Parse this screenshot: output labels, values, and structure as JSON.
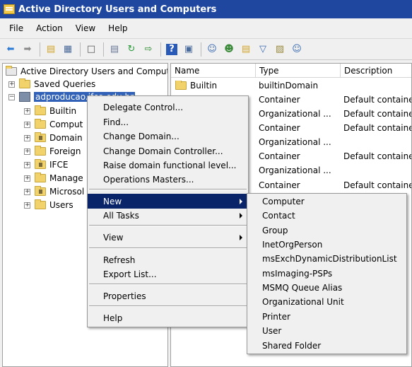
{
  "window": {
    "title": "Active Directory Users and Computers"
  },
  "menubar": {
    "items": [
      "File",
      "Action",
      "View",
      "Help"
    ]
  },
  "toolbar": {
    "buttons": [
      "back-icon",
      "forward-icon",
      "up-folder-icon",
      "show-hide-tree-icon",
      "clipboard-icon",
      "properties-icon",
      "refresh-icon",
      "export-icon",
      "help-icon",
      "console-icon",
      "new-user-icon",
      "new-group-icon",
      "new-ou-icon",
      "filter-icon",
      "find-icon",
      "add-to-group-icon"
    ]
  },
  "tree": {
    "root_label": "Active Directory Users and Comput",
    "saved_queries": "Saved Queries",
    "domain": "adproducao.ifce.edu.br",
    "children": [
      "Builtin",
      "Comput",
      "Domain",
      "Foreign",
      "IFCE",
      "Manage",
      "Microsol",
      "Users"
    ]
  },
  "list": {
    "columns": [
      "Name",
      "Type",
      "Description"
    ],
    "rows": [
      {
        "name": "Builtin",
        "type": "builtinDomain",
        "description": ""
      },
      {
        "name": "",
        "type": "Container",
        "description": "Default containe"
      },
      {
        "name": "",
        "type": "Organizational ...",
        "description": "Default containe"
      },
      {
        "name": "",
        "type": "Container",
        "description": "Default containe"
      },
      {
        "name": "",
        "type": "Organizational ...",
        "description": ""
      },
      {
        "name": "",
        "type": "Container",
        "description": "Default containe"
      },
      {
        "name": "",
        "type": "Organizational ...",
        "description": ""
      },
      {
        "name": "",
        "type": "Container",
        "description": "Default containe"
      }
    ]
  },
  "context_menu": {
    "delegate": "Delegate Control...",
    "find": "Find...",
    "change_domain": "Change Domain...",
    "change_dc": "Change Domain Controller...",
    "raise_level": "Raise domain functional level...",
    "ops_masters": "Operations Masters...",
    "new": "New",
    "all_tasks": "All Tasks",
    "view": "View",
    "refresh": "Refresh",
    "export": "Export List...",
    "properties": "Properties",
    "help": "Help"
  },
  "submenu": {
    "items": [
      "Computer",
      "Contact",
      "Group",
      "InetOrgPerson",
      "msExchDynamicDistributionList",
      "msImaging-PSPs",
      "MSMQ Queue Alias",
      "Organizational Unit",
      "Printer",
      "User",
      "Shared Folder"
    ]
  },
  "colors": {
    "title_bar": "#1f47a0",
    "highlight": "#0a246a",
    "selection": "#3162b8"
  }
}
